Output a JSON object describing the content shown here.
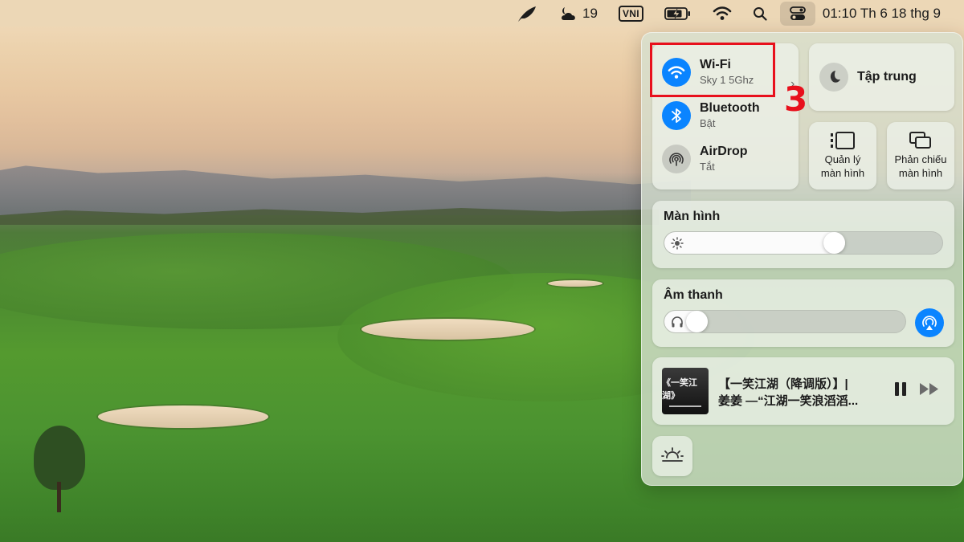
{
  "menubar": {
    "feather_icon": "feather-icon",
    "cloud_count": "19",
    "input_method": "VNI",
    "clock": "01:10 Th 6 18 thg 9"
  },
  "control_center": {
    "wifi": {
      "title": "Wi-Fi",
      "subtitle": "Sky 1 5Ghz",
      "state_color": "#0a84ff"
    },
    "bluetooth": {
      "title": "Bluetooth",
      "subtitle": "Bật",
      "state_color": "#0a84ff"
    },
    "airdrop": {
      "title": "AirDrop",
      "subtitle": "Tắt"
    },
    "focus": {
      "label": "Tập trung"
    },
    "stage_manager": {
      "label_line1": "Quản lý",
      "label_line2": "màn hình"
    },
    "screen_mirroring": {
      "label_line1": "Phản chiếu",
      "label_line2": "màn hình"
    },
    "display": {
      "heading": "Màn hình",
      "brightness": 0.62
    },
    "sound": {
      "heading": "Âm thanh",
      "volume": 0.1
    },
    "now_playing": {
      "line1": "【一笑江湖（降调版）】|",
      "line2": "姜姜 —“江湖一笑浪滔滔...",
      "album_title": "《一笑江湖》"
    },
    "accent_color": "#0a84ff"
  },
  "annotation": {
    "step_number": "3",
    "color": "#e8101c"
  }
}
